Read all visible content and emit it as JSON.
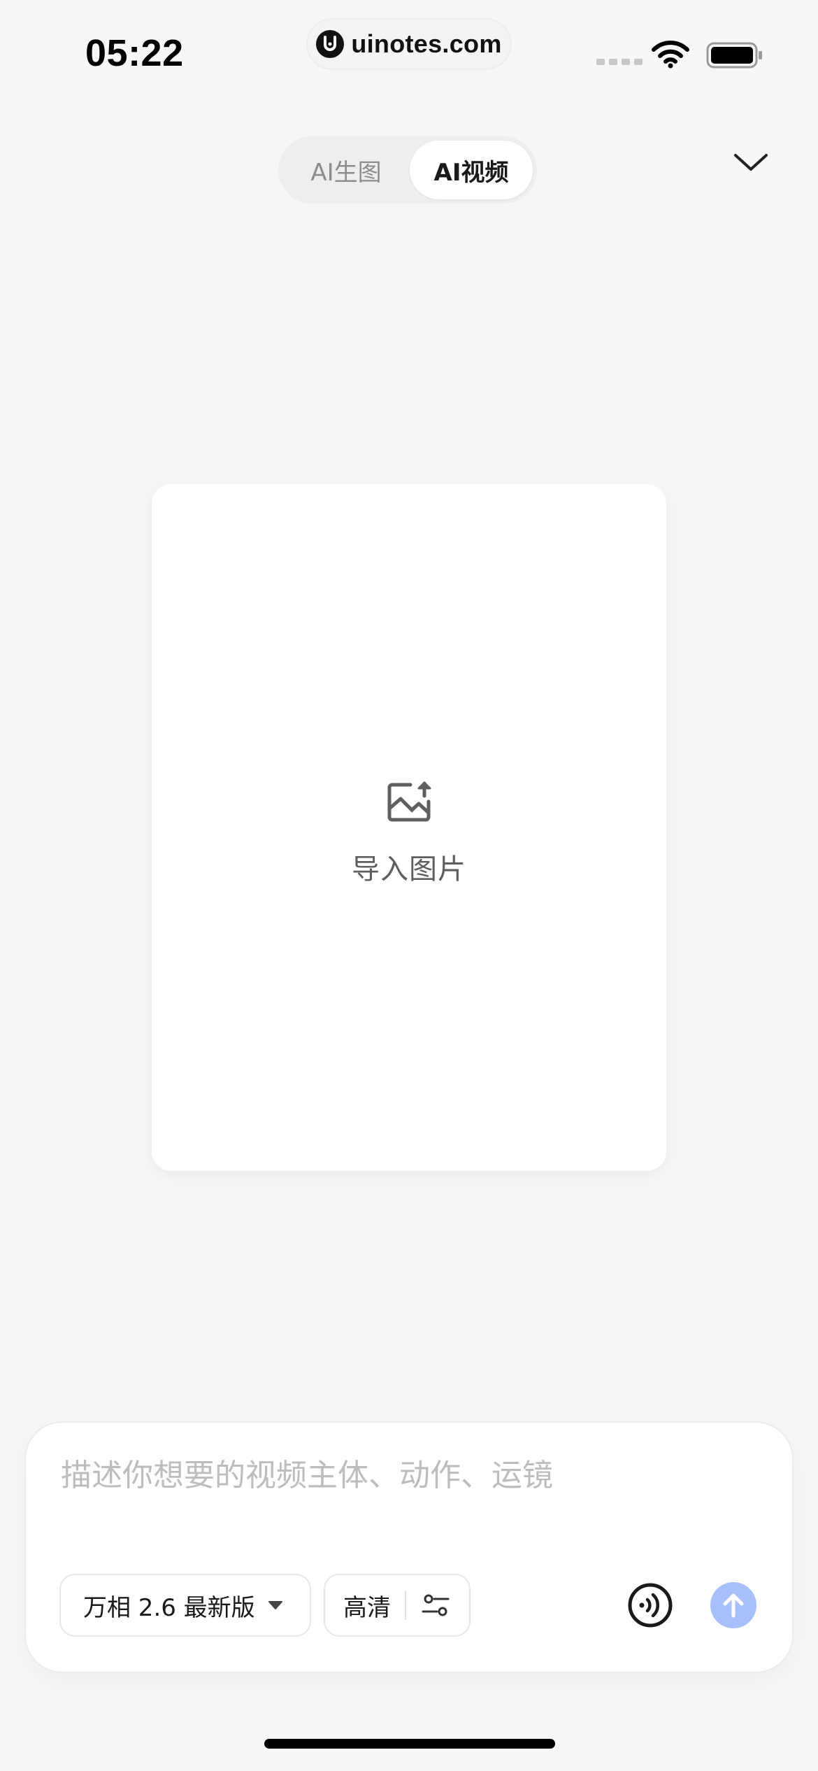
{
  "status_bar": {
    "time": "05:22",
    "watermark": "uinotes.com",
    "icons": [
      "cellular-signal-icon",
      "wifi-icon",
      "battery-icon"
    ]
  },
  "mode_switch": {
    "tabs": [
      {
        "label": "AI生图",
        "active": false
      },
      {
        "label": "AI视频",
        "active": true
      }
    ],
    "collapse_icon": "chevron-down-icon"
  },
  "upload_card": {
    "icon": "image-upload-icon",
    "label": "导入图片"
  },
  "prompt": {
    "placeholder": "描述你想要的视频主体、动作、运镜",
    "value": "",
    "model_label": "万相 2.6 最新版",
    "quality_label": "高清",
    "icons": [
      "caret-down-icon",
      "sliders-icon",
      "voice-icon",
      "arrow-up-icon"
    ]
  },
  "colors": {
    "background": "#f7f7f7",
    "card": "#ffffff",
    "send_button": "#a7c0fb",
    "placeholder": "#bdbdbd",
    "inactive_tab": "#8d8d8d"
  }
}
